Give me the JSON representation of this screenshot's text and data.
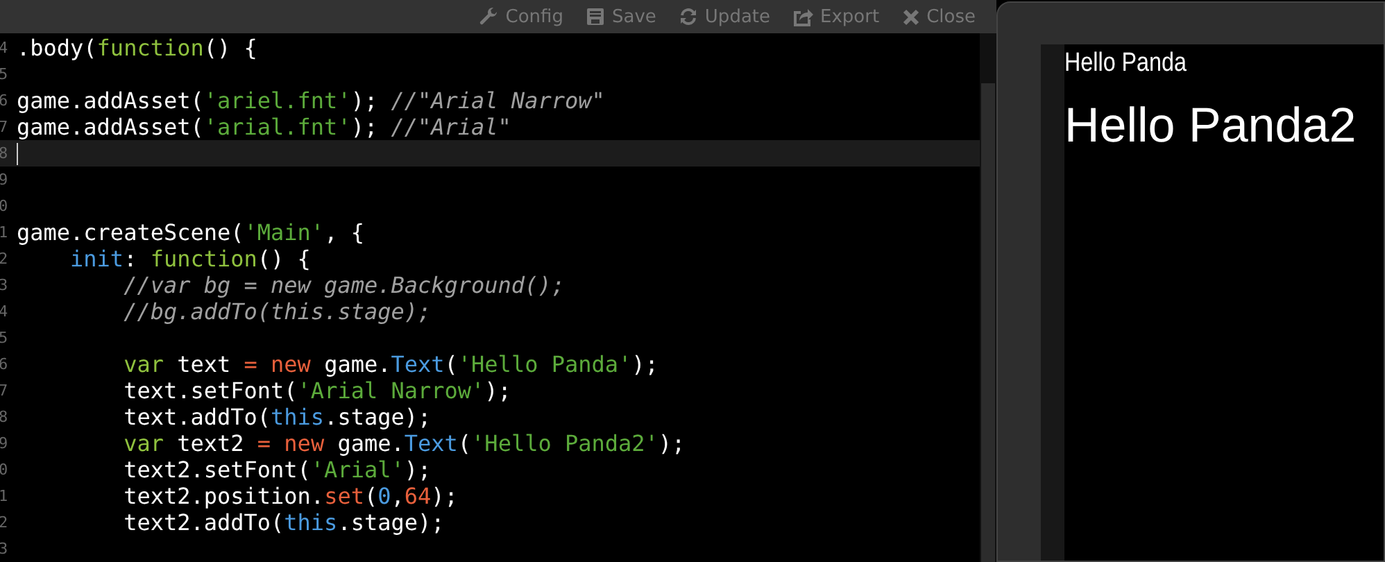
{
  "toolbar": {
    "buttons": [
      {
        "kind": "config",
        "label": "Config"
      },
      {
        "kind": "save",
        "label": "Save"
      },
      {
        "kind": "update",
        "label": "Update"
      },
      {
        "kind": "export",
        "label": "Export"
      },
      {
        "kind": "close",
        "label": "Close"
      }
    ]
  },
  "editor": {
    "lines": [
      {
        "number": "4",
        "current": false,
        "tokens": [
          {
            "kind": "plain",
            "text": ".body("
          },
          {
            "kind": "keyword",
            "text": "function"
          },
          {
            "kind": "plain",
            "text": "() {"
          }
        ]
      },
      {
        "number": "5",
        "current": false
      },
      {
        "number": "6",
        "current": false,
        "tokens": [
          {
            "kind": "plain",
            "text": "game.addAsset("
          },
          {
            "kind": "string",
            "text": "'ariel.fnt'"
          },
          {
            "kind": "plain",
            "text": "); "
          },
          {
            "kind": "comment",
            "text": "//\"Arial Narrow\""
          }
        ]
      },
      {
        "number": "7",
        "current": false,
        "tokens": [
          {
            "kind": "plain",
            "text": "game.addAsset("
          },
          {
            "kind": "string",
            "text": "'arial.fnt'"
          },
          {
            "kind": "plain",
            "text": "); "
          },
          {
            "kind": "comment",
            "text": "//\"Arial\""
          }
        ]
      },
      {
        "number": "8",
        "current": true
      },
      {
        "number": "9",
        "current": false
      },
      {
        "number": "0",
        "current": false
      },
      {
        "number": "1",
        "current": false,
        "tokens": [
          {
            "kind": "plain",
            "text": "game.createScene("
          },
          {
            "kind": "string",
            "text": "'Main'"
          },
          {
            "kind": "plain",
            "text": ", {"
          }
        ]
      },
      {
        "number": "2",
        "current": false,
        "tokens": [
          {
            "kind": "name",
            "text": "    init"
          },
          {
            "kind": "plain",
            "text": ": "
          },
          {
            "kind": "keyword",
            "text": "function"
          },
          {
            "kind": "plain",
            "text": "() {"
          }
        ]
      },
      {
        "number": "3",
        "current": false,
        "tokens": [
          {
            "kind": "comment",
            "text": "        //var bg = new game.Background();"
          }
        ]
      },
      {
        "number": "4",
        "current": false,
        "tokens": [
          {
            "kind": "comment",
            "text": "        //bg.addTo(this.stage);"
          }
        ]
      },
      {
        "number": "5",
        "current": false
      },
      {
        "number": "6",
        "current": false,
        "tokens": [
          {
            "kind": "keyword",
            "text": "        var"
          },
          {
            "kind": "plain",
            "text": " text "
          },
          {
            "kind": "operator",
            "text": "= new"
          },
          {
            "kind": "plain",
            "text": " game."
          },
          {
            "kind": "name",
            "text": "Text"
          },
          {
            "kind": "plain",
            "text": "("
          },
          {
            "kind": "string",
            "text": "'Hello Panda'"
          },
          {
            "kind": "plain",
            "text": ");"
          }
        ]
      },
      {
        "number": "7",
        "current": false,
        "tokens": [
          {
            "kind": "plain",
            "text": "        text.setFont("
          },
          {
            "kind": "string",
            "text": "'Arial Narrow'"
          },
          {
            "kind": "plain",
            "text": ");"
          }
        ]
      },
      {
        "number": "8",
        "current": false,
        "tokens": [
          {
            "kind": "plain",
            "text": "        text.addTo("
          },
          {
            "kind": "name",
            "text": "this"
          },
          {
            "kind": "plain",
            "text": ".stage);"
          }
        ]
      },
      {
        "number": "9",
        "current": false,
        "tokens": [
          {
            "kind": "keyword",
            "text": "        var"
          },
          {
            "kind": "plain",
            "text": " text2 "
          },
          {
            "kind": "operator",
            "text": "= new"
          },
          {
            "kind": "plain",
            "text": " game."
          },
          {
            "kind": "name",
            "text": "Text"
          },
          {
            "kind": "plain",
            "text": "("
          },
          {
            "kind": "string",
            "text": "'Hello Panda2'"
          },
          {
            "kind": "plain",
            "text": ");"
          }
        ]
      },
      {
        "number": "0",
        "current": false,
        "tokens": [
          {
            "kind": "plain",
            "text": "        text2.setFont("
          },
          {
            "kind": "string",
            "text": "'Arial'"
          },
          {
            "kind": "plain",
            "text": ");"
          }
        ]
      },
      {
        "number": "1",
        "current": false,
        "tokens": [
          {
            "kind": "plain",
            "text": "        text2.position."
          },
          {
            "kind": "operator",
            "text": "set"
          },
          {
            "kind": "plain",
            "text": "("
          },
          {
            "kind": "name",
            "text": "0"
          },
          {
            "kind": "plain",
            "text": ","
          },
          {
            "kind": "operator",
            "text": "64"
          },
          {
            "kind": "plain",
            "text": ");"
          }
        ]
      },
      {
        "number": "2",
        "current": false,
        "tokens": [
          {
            "kind": "plain",
            "text": "        text2.addTo("
          },
          {
            "kind": "name",
            "text": "this"
          },
          {
            "kind": "plain",
            "text": ".stage);"
          }
        ]
      },
      {
        "number": "3",
        "current": false
      }
    ]
  },
  "preview": {
    "texts": [
      {
        "kind": "small",
        "text": "Hello Panda"
      },
      {
        "kind": "large",
        "text": "Hello Panda2"
      }
    ]
  }
}
